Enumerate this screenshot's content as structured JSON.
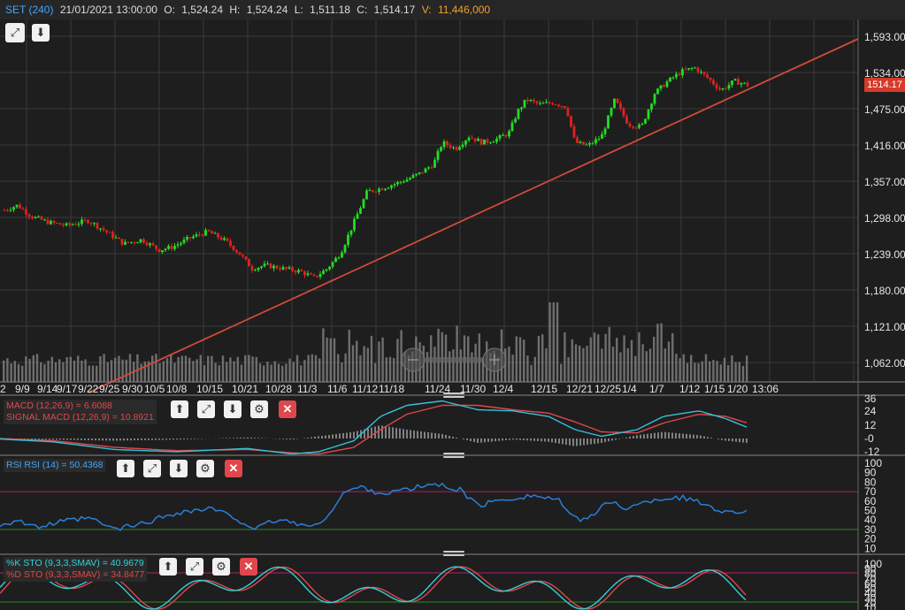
{
  "header": {
    "symbol": "SET (240)",
    "datetime": "21/01/2021 13:00:00",
    "open_label": "O:",
    "open": "1,524.24",
    "high_label": "H:",
    "high": "1,524.24",
    "low_label": "L:",
    "low": "1,511.18",
    "close_label": "C:",
    "close": "1,514.17",
    "volume_label": "V:",
    "volume": "11,446,000"
  },
  "price_axis": [
    "1,593.00",
    "1,534.00",
    "1,475.00",
    "1,416.00",
    "1,357.00",
    "1,298.00",
    "1,239.00",
    "1,180.00",
    "1,121.00",
    "1,062.00"
  ],
  "last_price": "1514.17",
  "date_axis": [
    "2",
    "9/9",
    "9/14",
    "9/17",
    "9/22",
    "9/25",
    "9/30",
    "10/5",
    "10/8",
    "10/15",
    "10/21",
    "10/28",
    "11/3",
    "11/6",
    "11/12",
    "11/18",
    "11/24",
    "11/30",
    "12/4",
    "12/15",
    "12/21",
    "12/25",
    "1/4",
    "1/7",
    "1/12",
    "1/15",
    "1/20",
    "13:06"
  ],
  "macd": {
    "label_macd": "MACD (12,26,9) = 6.6088",
    "label_signal": "SIGNAL MACD (12,26,9) = 10.8921",
    "axis": [
      "36",
      "24",
      "12",
      "-0",
      "-12"
    ]
  },
  "rsi": {
    "label": "RSI RSI (14) = 50.4368",
    "axis": [
      "100",
      "90",
      "80",
      "70",
      "60",
      "50",
      "40",
      "30",
      "20",
      "10"
    ]
  },
  "sto": {
    "label_k": "%K STO (9,3,3,SMAV) = 40.9679",
    "label_d": "%D STO (9,3,3,SMAV) = 34.8477",
    "axis": [
      "100",
      "90",
      "80",
      "70",
      "60",
      "50",
      "40",
      "30",
      "20",
      "10"
    ]
  },
  "icons": {
    "expand": "expand-icon",
    "down": "arrow-down-icon",
    "up": "arrow-up-icon",
    "gear": "gear-icon",
    "close": "close-icon"
  },
  "colors": {
    "up": "#22dd22",
    "down": "#dd2222",
    "trendline": "#d24a3a",
    "macd": "#36c0d8",
    "signal": "#e0474c",
    "rsi": "#2a7fd8",
    "sto_k": "#36d0d8",
    "sto_d": "#e0474c",
    "price_badge": "#d63a2a"
  }
}
